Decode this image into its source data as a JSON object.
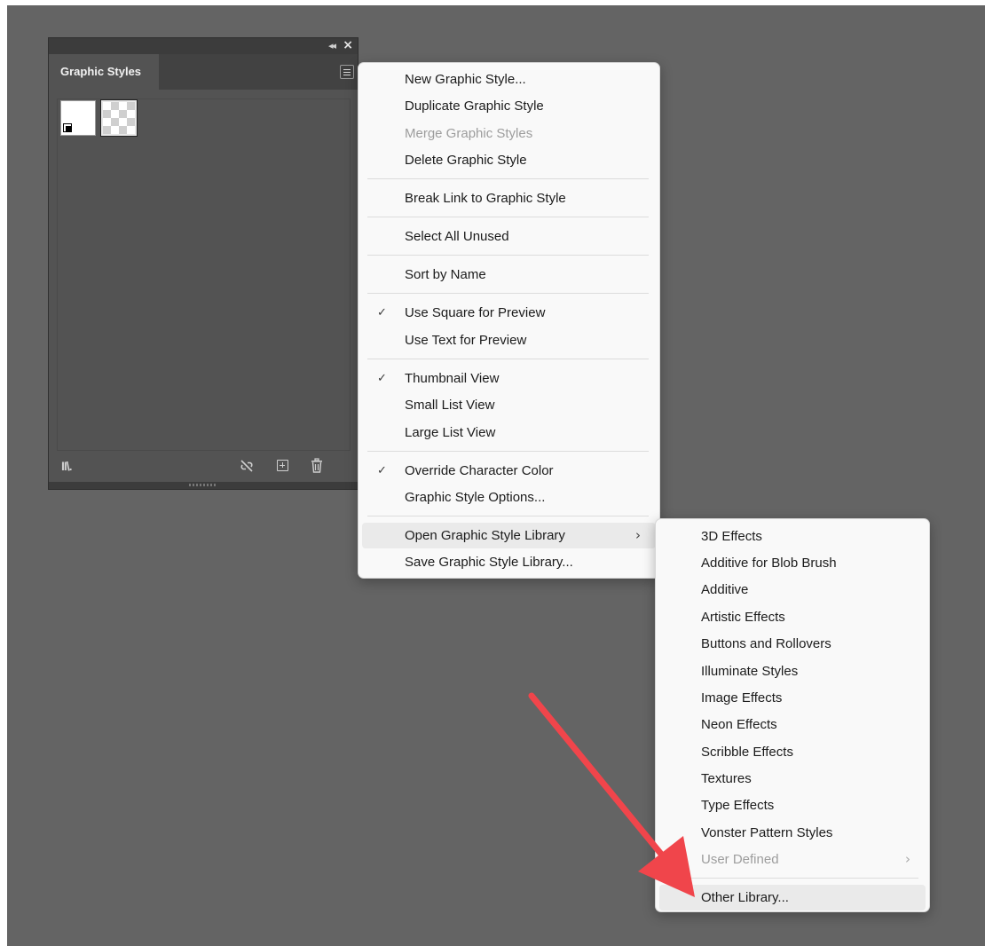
{
  "panel": {
    "tab_label": "Graphic Styles",
    "swatches": [
      "default-style-swatch",
      "transparent-style-swatch"
    ],
    "icons": {
      "collapse": "double-chevron-left-icon",
      "close": "close-icon",
      "panel_menu": "hamburger-menu-icon",
      "library": "graphic-style-libraries-icon",
      "break_link": "break-link-icon",
      "new_style": "new-graphic-style-icon",
      "delete": "trash-icon"
    }
  },
  "main_menu": {
    "items": [
      {
        "label": "New Graphic Style..."
      },
      {
        "label": "Duplicate Graphic Style"
      },
      {
        "label": "Merge Graphic Styles",
        "disabled": true
      },
      {
        "label": "Delete Graphic Style"
      },
      {
        "label": "Break Link to Graphic Style"
      },
      {
        "label": "Select All Unused"
      },
      {
        "label": "Sort by Name"
      },
      {
        "label": "Use Square for Preview",
        "checked": true
      },
      {
        "label": "Use Text for Preview"
      },
      {
        "label": "Thumbnail View",
        "checked": true
      },
      {
        "label": "Small List View"
      },
      {
        "label": "Large List View"
      },
      {
        "label": "Override Character Color",
        "checked": true
      },
      {
        "label": "Graphic Style Options..."
      },
      {
        "label": "Open Graphic Style Library",
        "submenu": true,
        "highlighted": true
      },
      {
        "label": "Save Graphic Style Library..."
      }
    ]
  },
  "sub_menu": {
    "items": [
      {
        "label": "3D Effects"
      },
      {
        "label": "Additive for Blob Brush"
      },
      {
        "label": "Additive"
      },
      {
        "label": "Artistic Effects"
      },
      {
        "label": "Buttons and Rollovers"
      },
      {
        "label": "Illuminate Styles"
      },
      {
        "label": "Image Effects"
      },
      {
        "label": "Neon Effects"
      },
      {
        "label": "Scribble Effects"
      },
      {
        "label": "Textures"
      },
      {
        "label": "Type Effects"
      },
      {
        "label": "Vonster Pattern Styles"
      },
      {
        "label": "User Defined",
        "disabled": true,
        "submenu": true
      },
      {
        "label": "Other Library...",
        "highlighted": true
      }
    ]
  },
  "glyphs": {
    "check": "✓",
    "submenu_arrow": "›"
  },
  "colors": {
    "canvas": "#646464",
    "panel": "#535353",
    "menu_bg": "#f9f9f9",
    "menu_text": "#1b1b1b",
    "disabled_text": "#9d9d9d",
    "highlight": "#eaeaea",
    "annotation_arrow": "#f0454b"
  }
}
